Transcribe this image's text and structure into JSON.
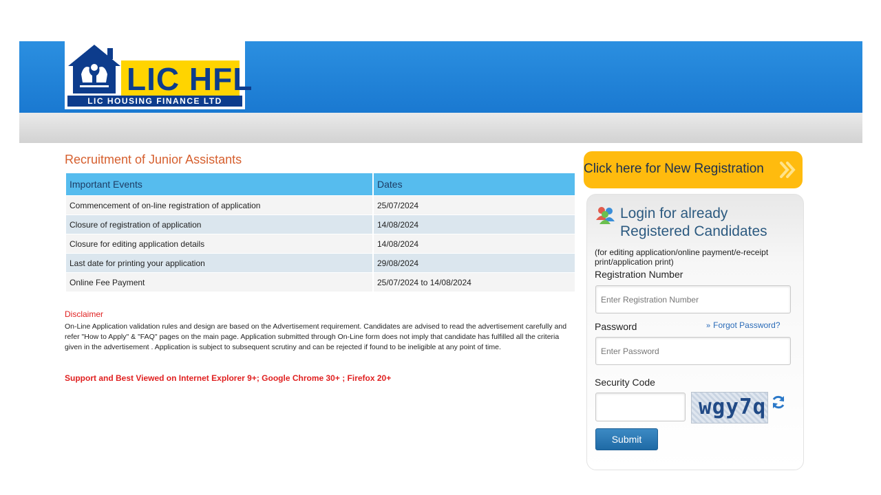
{
  "brand": {
    "logo_main": "LIC HFL",
    "logo_sub": "LIC HOUSING FINANCE LTD"
  },
  "content": {
    "title": "Recruitment of Junior Assistants",
    "table": {
      "headers": [
        "Important Events",
        "Dates"
      ],
      "rows": [
        [
          "Commencement of on-line registration of application",
          "25/07/2024"
        ],
        [
          "Closure of registration of application",
          "14/08/2024"
        ],
        [
          "Closure for editing application details",
          "14/08/2024"
        ],
        [
          "Last date for printing your application",
          "29/08/2024"
        ],
        [
          "Online Fee Payment",
          "25/07/2024 to 14/08/2024"
        ]
      ]
    },
    "disclaimer_title": "Disclaimer",
    "disclaimer_text": "On-Line Application validation rules and design are based on the Advertisement requirement. Candidates are advised to read the advertisement carefully and refer \"How to Apply\" & \"FAQ\" pages on the main page. Application submitted through On-Line form does not imply that candidate has fulfilled all the criteria given in the advertisement . Application is subject to subsequent scrutiny and can be rejected if found to be ineligible at any point of time.",
    "support_note": "Support and Best Viewed on Internet Explorer 9+; Google Chrome 30+ ; Firefox 20+"
  },
  "sidebar": {
    "new_registration_label": "Click here for New Registration",
    "login": {
      "title": "Login for already Registered Candidates",
      "hint": "(for editing application/online payment/e-receipt print/application print)",
      "registration_label": "Registration Number",
      "registration_placeholder": "Enter Registration Number",
      "password_label": "Password",
      "password_placeholder": "Enter Password",
      "forgot_label": "Forgot Password?",
      "forgot_arrow": "»",
      "security_label": "Security Code",
      "captcha_text": "wgy7q",
      "submit_label": "Submit"
    }
  },
  "colors": {
    "header_blue": "#1a79d1",
    "brand_yellow": "#ffd400",
    "cta_orange": "#ffbb0e",
    "table_header": "#56bcee",
    "title_orange": "#d65f2e",
    "alert_red": "#e02020"
  },
  "icons": {
    "logo": "house-hands-icon",
    "new_registration": "double-chevron-right-icon",
    "login": "users-icon",
    "captcha_refresh": "refresh-icon"
  }
}
